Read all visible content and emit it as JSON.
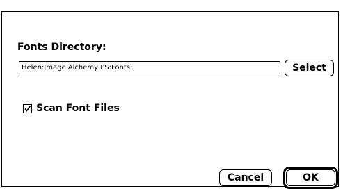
{
  "dialog": {
    "fonts_directory_label": "Fonts Directory:",
    "fonts_directory_value": "Helen:Image Alchemy PS:Fonts:",
    "select_label": "Select",
    "scan_font_files_label": "Scan Font Files",
    "scan_font_files_checked": true,
    "cancel_label": "Cancel",
    "ok_label": "OK"
  },
  "icons": {
    "checkmark": "checkmark-icon"
  }
}
